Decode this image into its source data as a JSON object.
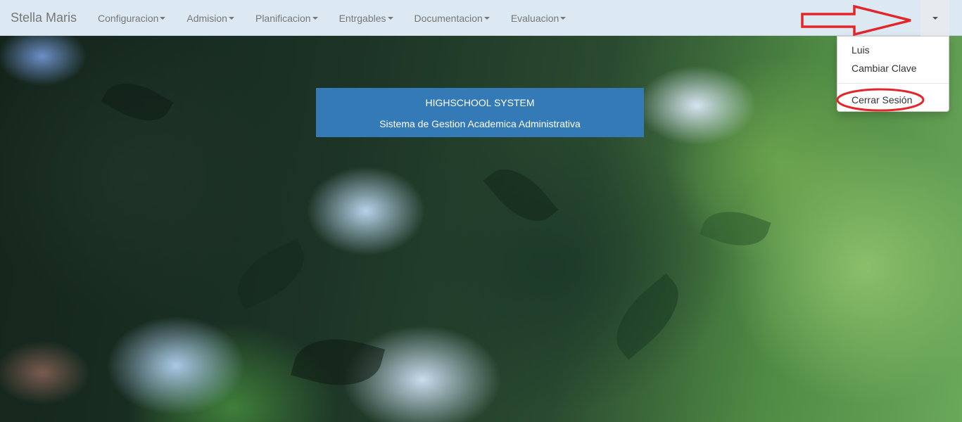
{
  "navbar": {
    "brand": "Stella Maris",
    "menus": [
      {
        "label": "Configuracion"
      },
      {
        "label": "Admision"
      },
      {
        "label": "Planificacion"
      },
      {
        "label": "Entrgables"
      },
      {
        "label": "Documentacion"
      },
      {
        "label": "Evaluacion"
      }
    ],
    "user_menu_icon": "caret-down-icon"
  },
  "user_dropdown": {
    "items": [
      {
        "label": "Luis"
      },
      {
        "label": "Cambiar Clave"
      },
      {
        "label": "Cerrar Sesión"
      }
    ]
  },
  "banner": {
    "title": "HIGHSCHOOL SYSTEM",
    "subtitle": "Sistema de Gestion Academica Administrativa"
  },
  "annotations": {
    "arrow_color": "#e3262b",
    "circle_color": "#e3262b"
  },
  "colors": {
    "navbar_bg": "#dde9f2",
    "banner_bg": "#337ab7"
  }
}
